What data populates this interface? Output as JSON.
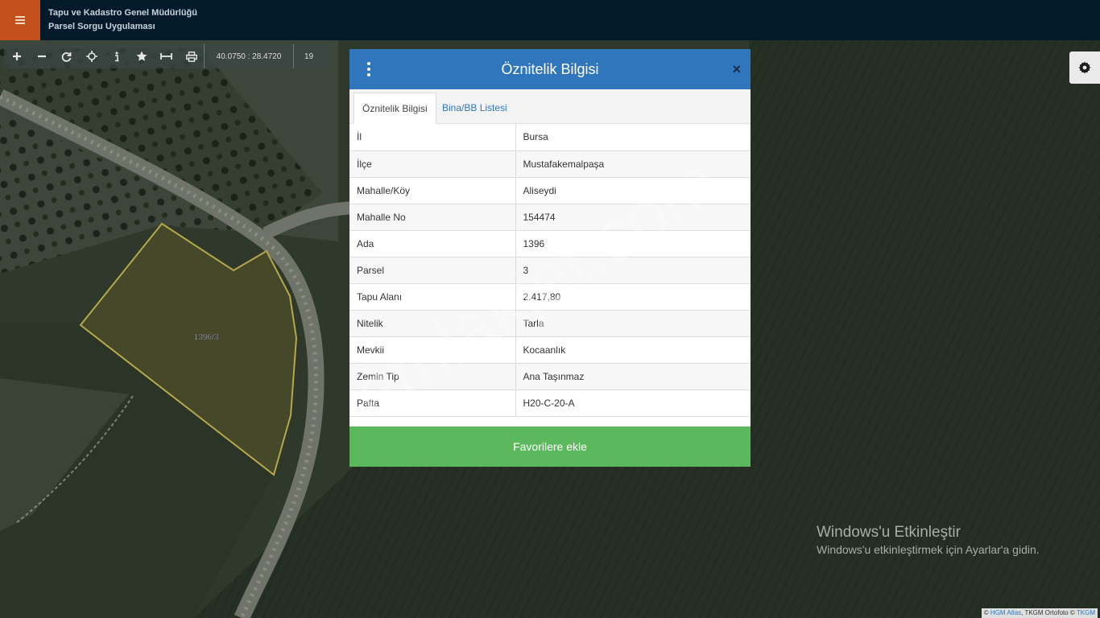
{
  "header": {
    "title_line1": "Tapu ve Kadastro Genel Müdürlüğü",
    "title_line2": "Parsel Sorgu Uygulaması",
    "menu_icon": "hamburger-icon"
  },
  "toolbar": {
    "coordinates": "40.0750 : 28.4720",
    "zoom_level": "19",
    "buttons": [
      "zoom-in-icon",
      "zoom-out-icon",
      "refresh-icon",
      "locate-icon",
      "info-icon",
      "star-icon",
      "measure-icon",
      "print-icon"
    ]
  },
  "map": {
    "parcel_label": "1396/3",
    "parcel_outline_color": "#b6a84a",
    "watermark": "emlakjet.com"
  },
  "panel": {
    "title": "Öznitelik Bilgisi",
    "close_glyph": "×",
    "tabs": [
      {
        "label": "Öznitelik Bilgisi",
        "active": true
      },
      {
        "label": "Bina/BB Listesi",
        "active": false
      }
    ],
    "rows": [
      {
        "key": "İl",
        "value": "Bursa"
      },
      {
        "key": "İlçe",
        "value": "Mustafakemalpaşa"
      },
      {
        "key": "Mahalle/Köy",
        "value": "Aliseydi"
      },
      {
        "key": "Mahalle No",
        "value": "154474"
      },
      {
        "key": "Ada",
        "value": "1396"
      },
      {
        "key": "Parsel",
        "value": "3"
      },
      {
        "key": "Tapu Alanı",
        "value": "2.417,80"
      },
      {
        "key": "Nitelik",
        "value": "Tarla"
      },
      {
        "key": "Mevkii",
        "value": "Kocaanlık"
      },
      {
        "key": "Zemin Tip",
        "value": "Ana Taşınmaz"
      },
      {
        "key": "Pafta",
        "value": "H20-C-20-A"
      }
    ],
    "favorite_button": "Favorilere ekle",
    "header_color": "#2f76bc",
    "button_color": "#5cb85c"
  },
  "windows_activation": {
    "title": "Windows'u Etkinleştir",
    "subtitle": "Windows'u etkinleştirmek için Ayarlar'a gidin."
  },
  "attribution": {
    "prefix": "© ",
    "link1": "HGM Atlas",
    "middle": ", TKGM Ortofoto © ",
    "link2": "TKGM"
  }
}
